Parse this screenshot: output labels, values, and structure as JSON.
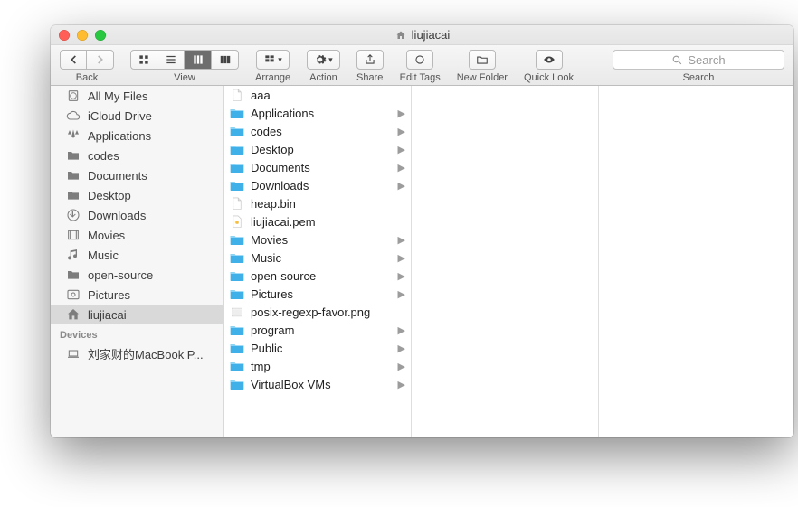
{
  "window": {
    "title": "liujiacai"
  },
  "toolbar": {
    "back_label": "Back",
    "view_label": "View",
    "arrange_label": "Arrange",
    "action_label": "Action",
    "share_label": "Share",
    "edit_tags_label": "Edit Tags",
    "new_folder_label": "New Folder",
    "quick_look_label": "Quick Look",
    "search_label": "Search",
    "search_placeholder": "Search"
  },
  "sidebar": {
    "favorites": [
      {
        "label": "All My Files",
        "icon": "allfiles"
      },
      {
        "label": "iCloud Drive",
        "icon": "cloud"
      },
      {
        "label": "Applications",
        "icon": "apps"
      },
      {
        "label": "codes",
        "icon": "folder"
      },
      {
        "label": "Documents",
        "icon": "folder"
      },
      {
        "label": "Desktop",
        "icon": "folder"
      },
      {
        "label": "Downloads",
        "icon": "downloads"
      },
      {
        "label": "Movies",
        "icon": "movies"
      },
      {
        "label": "Music",
        "icon": "music"
      },
      {
        "label": "open-source",
        "icon": "folder"
      },
      {
        "label": "Pictures",
        "icon": "pictures"
      },
      {
        "label": "liujiacai",
        "icon": "home",
        "selected": true
      }
    ],
    "devices_header": "Devices",
    "devices": [
      {
        "label": "刘家财的MacBook P...",
        "icon": "laptop"
      }
    ]
  },
  "column": [
    {
      "name": "aaa",
      "type": "file"
    },
    {
      "name": "Applications",
      "type": "folder"
    },
    {
      "name": "codes",
      "type": "folder"
    },
    {
      "name": "Desktop",
      "type": "folder"
    },
    {
      "name": "Documents",
      "type": "folder"
    },
    {
      "name": "Downloads",
      "type": "folder"
    },
    {
      "name": "heap.bin",
      "type": "file"
    },
    {
      "name": "liujiacai.pem",
      "type": "cert"
    },
    {
      "name": "Movies",
      "type": "folder"
    },
    {
      "name": "Music",
      "type": "folder"
    },
    {
      "name": "open-source",
      "type": "folder"
    },
    {
      "name": "Pictures",
      "type": "folder"
    },
    {
      "name": "posix-regexp-favor.png",
      "type": "image"
    },
    {
      "name": "program",
      "type": "folder"
    },
    {
      "name": "Public",
      "type": "folder"
    },
    {
      "name": "tmp",
      "type": "folder"
    },
    {
      "name": "VirtualBox VMs",
      "type": "folder"
    }
  ]
}
